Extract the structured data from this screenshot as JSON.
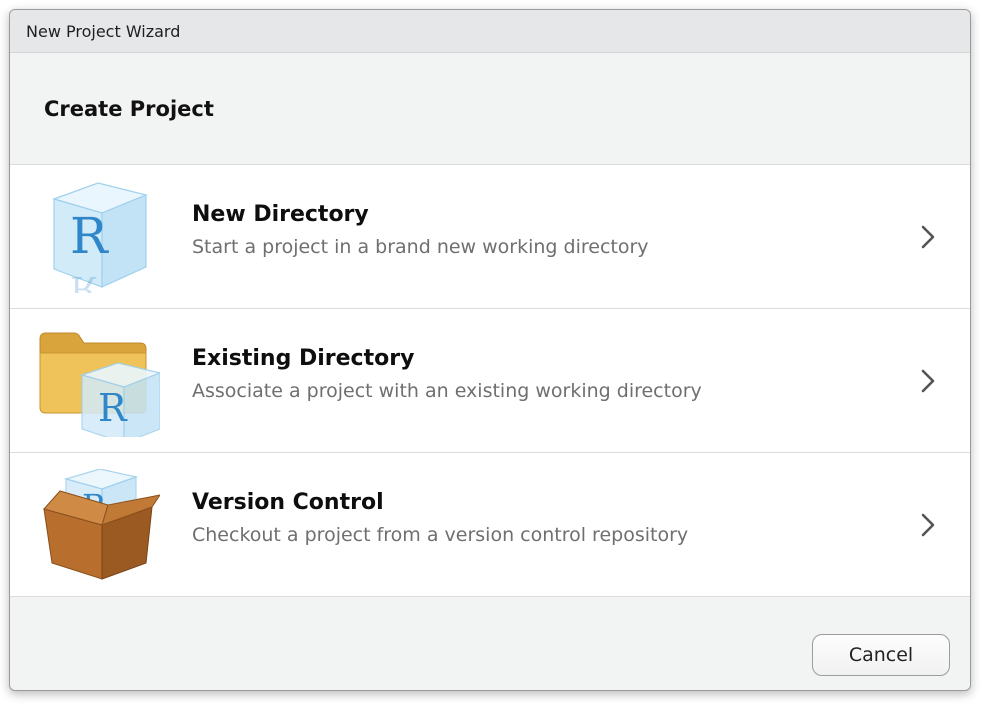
{
  "window": {
    "title": "New Project Wizard"
  },
  "header": {
    "title": "Create Project"
  },
  "options": [
    {
      "title": "New Directory",
      "description": "Start a project in a brand new working directory",
      "icon": "r-cube-icon"
    },
    {
      "title": "Existing Directory",
      "description": "Associate a project with an existing working directory",
      "icon": "folder-r-cube-icon"
    },
    {
      "title": "Version Control",
      "description": "Checkout a project from a version control repository",
      "icon": "box-r-cube-icon"
    }
  ],
  "footer": {
    "cancel_label": "Cancel"
  },
  "colors": {
    "r_blue": "#2f86c8",
    "cube_face": "#d6ecf8",
    "folder": "#e9b84a",
    "box": "#b86f2e",
    "chevron": "#555555"
  }
}
